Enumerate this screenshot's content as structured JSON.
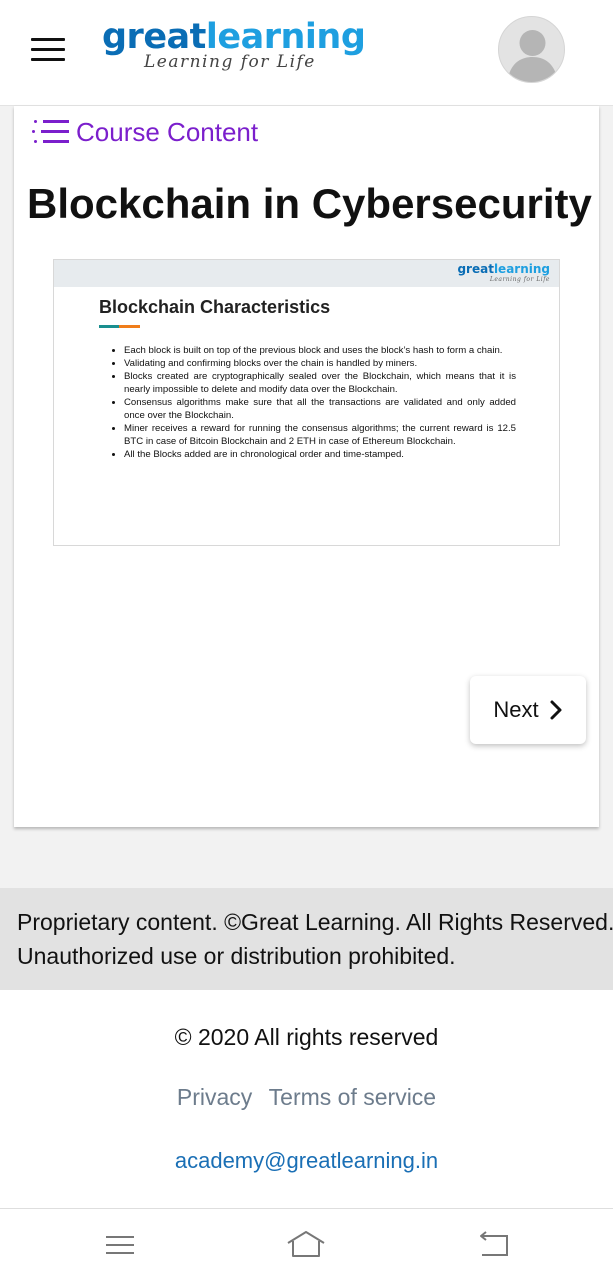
{
  "header": {
    "logo_word_part1": "great",
    "logo_word_part2": "learning",
    "logo_tagline": "Learning for Life",
    "brand_color": "#0a6db5"
  },
  "course_content": {
    "label": "Course Content",
    "icon": "list-icon",
    "color": "#7b1fcc"
  },
  "page_title": "Blockchain in Cybersecurity",
  "slide": {
    "logo_word_part1": "great",
    "logo_word_part2": "learning",
    "logo_tagline": "Learning for Life",
    "heading": "Blockchain Characteristics",
    "bullets": [
      "Each block is built on top of the previous block and uses the block’s hash to form a chain.",
      "Validating and confirming blocks over the chain is handled by miners.",
      "Blocks created are cryptographically sealed over the Blockchain, which means that it is nearly impossible to delete and modify data over the Blockchain.",
      "Consensus algorithms make sure that all the transactions are validated and only added once over the Blockchain.",
      "Miner receives a reward for running the consensus algorithms; the current reward is 12.5 BTC in case of Bitcoin Blockchain and 2 ETH in case of Ethereum Blockchain.",
      "All the Blocks added are in chronological order and time-stamped."
    ]
  },
  "next_button": {
    "label": "Next",
    "icon": "chevron-right-icon"
  },
  "banner": {
    "text": "Proprietary content. ©Great Learning. All Rights Reserved. Unauthorized use or distribution prohibited."
  },
  "footer": {
    "copyright": "© 2020 All rights reserved",
    "privacy_label": "Privacy",
    "terms_label": "Terms of service",
    "email": "academy@greatlearning.in"
  },
  "system_nav": {
    "icons": [
      "menu-icon",
      "home-icon",
      "back-icon"
    ]
  }
}
